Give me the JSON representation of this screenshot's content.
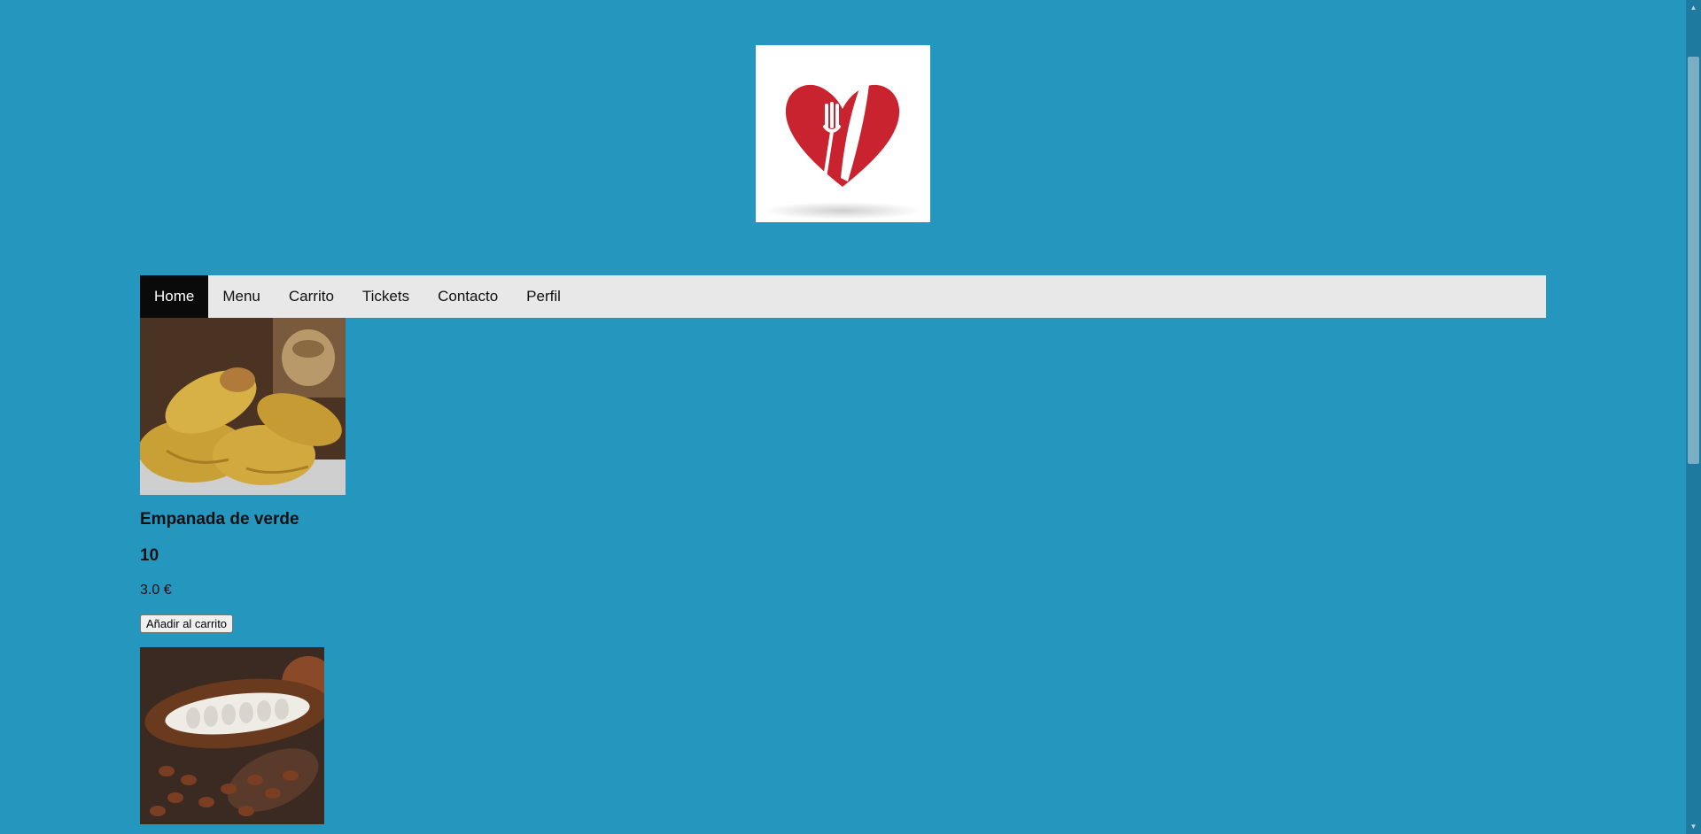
{
  "brand": {
    "logo_icon": "heart-fork-knife-logo",
    "heart_color": "#c8232f"
  },
  "nav": {
    "items": [
      {
        "label": "Home",
        "active": true
      },
      {
        "label": "Menu"
      },
      {
        "label": "Carrito"
      },
      {
        "label": "Tickets"
      },
      {
        "label": "Contacto"
      },
      {
        "label": "Perfil"
      }
    ]
  },
  "products": [
    {
      "image_icon": "empanadas-photo",
      "name": "Empanada de verde",
      "quantity": "10",
      "price": "3.0 €",
      "button_label": "Añadir al carrito"
    },
    {
      "image_icon": "cacao-pod-photo"
    }
  ],
  "colors": {
    "page_background": "#2596be",
    "nav_background": "#e8e8e8",
    "nav_active": "#0a0a0a"
  }
}
